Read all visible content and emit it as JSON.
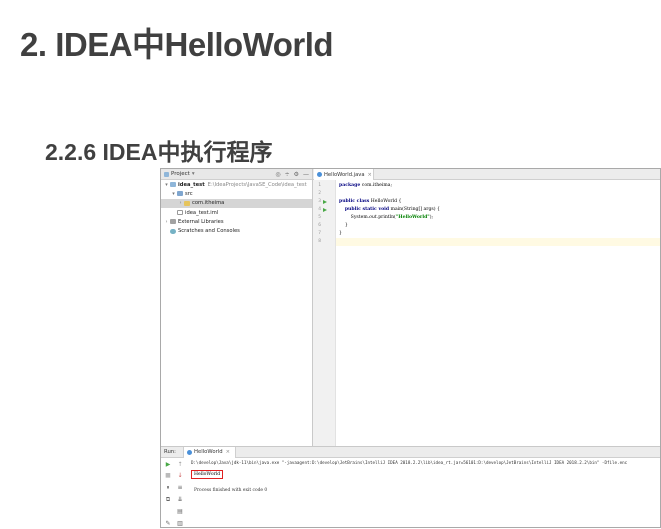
{
  "slide": {
    "title": "2. IDEA中HelloWorld",
    "subtitle": "2.2.6 IDEA中执行程序"
  },
  "colors": {
    "title": "#404040",
    "highlight_box": "#e02020",
    "run_icon": "#49a846",
    "keyword": "#000080",
    "string": "#008000"
  },
  "project_panel": {
    "header": "Project",
    "header_icons": [
      "target-icon",
      "split-icon",
      "gear-icon",
      "minimize-icon"
    ],
    "tree": [
      {
        "label": "idea_test",
        "path": "E:\\IdeaProjects\\JavaSE_Code\\idea_test",
        "icon": "folder-icon",
        "expanded": true
      },
      {
        "label": "src",
        "icon": "src-folder-icon",
        "expanded": true
      },
      {
        "label": "com.itheima",
        "icon": "package-icon",
        "expanded": false,
        "selected": true
      },
      {
        "label": "idea_test.iml",
        "icon": "file-icon"
      },
      {
        "label": "External Libraries",
        "icon": "library-icon",
        "expanded": false
      },
      {
        "label": "Scratches and Consoles",
        "icon": "scratch-icon"
      }
    ]
  },
  "editor": {
    "tab": "HelloWorld.java",
    "line_numbers": [
      "1",
      "2",
      "3",
      "4",
      "5",
      "6",
      "7",
      "8"
    ],
    "lines": [
      "package com.itheima;",
      "",
      "public class HelloWorld {",
      "    public static void main(String[] args) {",
      "        System.out.println(\"HelloWorld\");",
      "    }",
      "}",
      ""
    ]
  },
  "run_panel": {
    "label": "Run:",
    "tab": "HelloWorld",
    "command": "D:\\develop\\Java\\jdk-11\\bin\\java.exe \"-javaagent:D:\\develop\\JetBrains\\IntelliJ IDEA 2018.2.2\\lib\\idea_rt.jar=56101:D:\\develop\\JetBrains\\IntelliJ IDEA 2018.2.2\\bin\" -Dfile.enc",
    "output": "HelloWorld",
    "finished": "Process finished with exit code 0"
  }
}
